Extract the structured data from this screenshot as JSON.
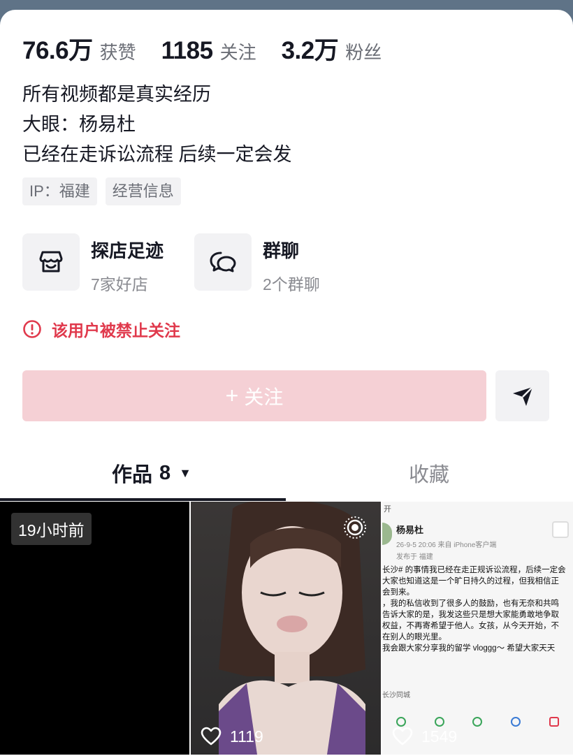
{
  "stats": [
    {
      "num": "76.6万",
      "label": "获赞"
    },
    {
      "num": "1185",
      "label": "关注"
    },
    {
      "num": "3.2万",
      "label": "粉丝"
    }
  ],
  "bio": [
    "所有视频都是真实经历",
    "大眼：杨易杜",
    "已经在走诉讼流程 后续一定会发"
  ],
  "tags": [
    "IP：福建",
    "经营信息"
  ],
  "cards": [
    {
      "title": "探店足迹",
      "sub": "7家好店",
      "icon": "shop-icon"
    },
    {
      "title": "群聊",
      "sub": "2个群聊",
      "icon": "chat-bubbles-icon"
    }
  ],
  "notice": {
    "text": "该用户被禁止关注",
    "color": "#e0394c"
  },
  "actions": {
    "follow_plus": "+",
    "follow_label": "关注"
  },
  "tabs": {
    "works_label": "作品",
    "works_count": "8",
    "favorites_label": "收藏"
  },
  "videos": [
    {
      "badge": "19小时前"
    },
    {
      "likes": "1119"
    },
    {
      "likes": "1549"
    }
  ],
  "post": {
    "top": "开",
    "author": "杨易杜",
    "time": "26-9-5 20:06  来自 iPhone客户端",
    "location": "发布于 福建",
    "lines": [
      "长沙# 的事情我已经在走正规诉讼流程，后续一定会",
      "大家也知道这是一个旷日持久的过程，但我相信正",
      "会到来。",
      "，我的私信收到了很多人的鼓励，也有无奈和共鸣",
      "告诉大家的是，我发这些只是想大家能勇敢地争取",
      "权益，不再寄希望于他人。女孩，从今天开始，不",
      "在别人的眼光里。",
      "我会跟大家分享我的留学 vloggg～ 希望大家天天"
    ],
    "city": "长沙同城"
  },
  "colors": {
    "accent_red": "#e0394c",
    "follow_bg": "#f5d0d5"
  }
}
